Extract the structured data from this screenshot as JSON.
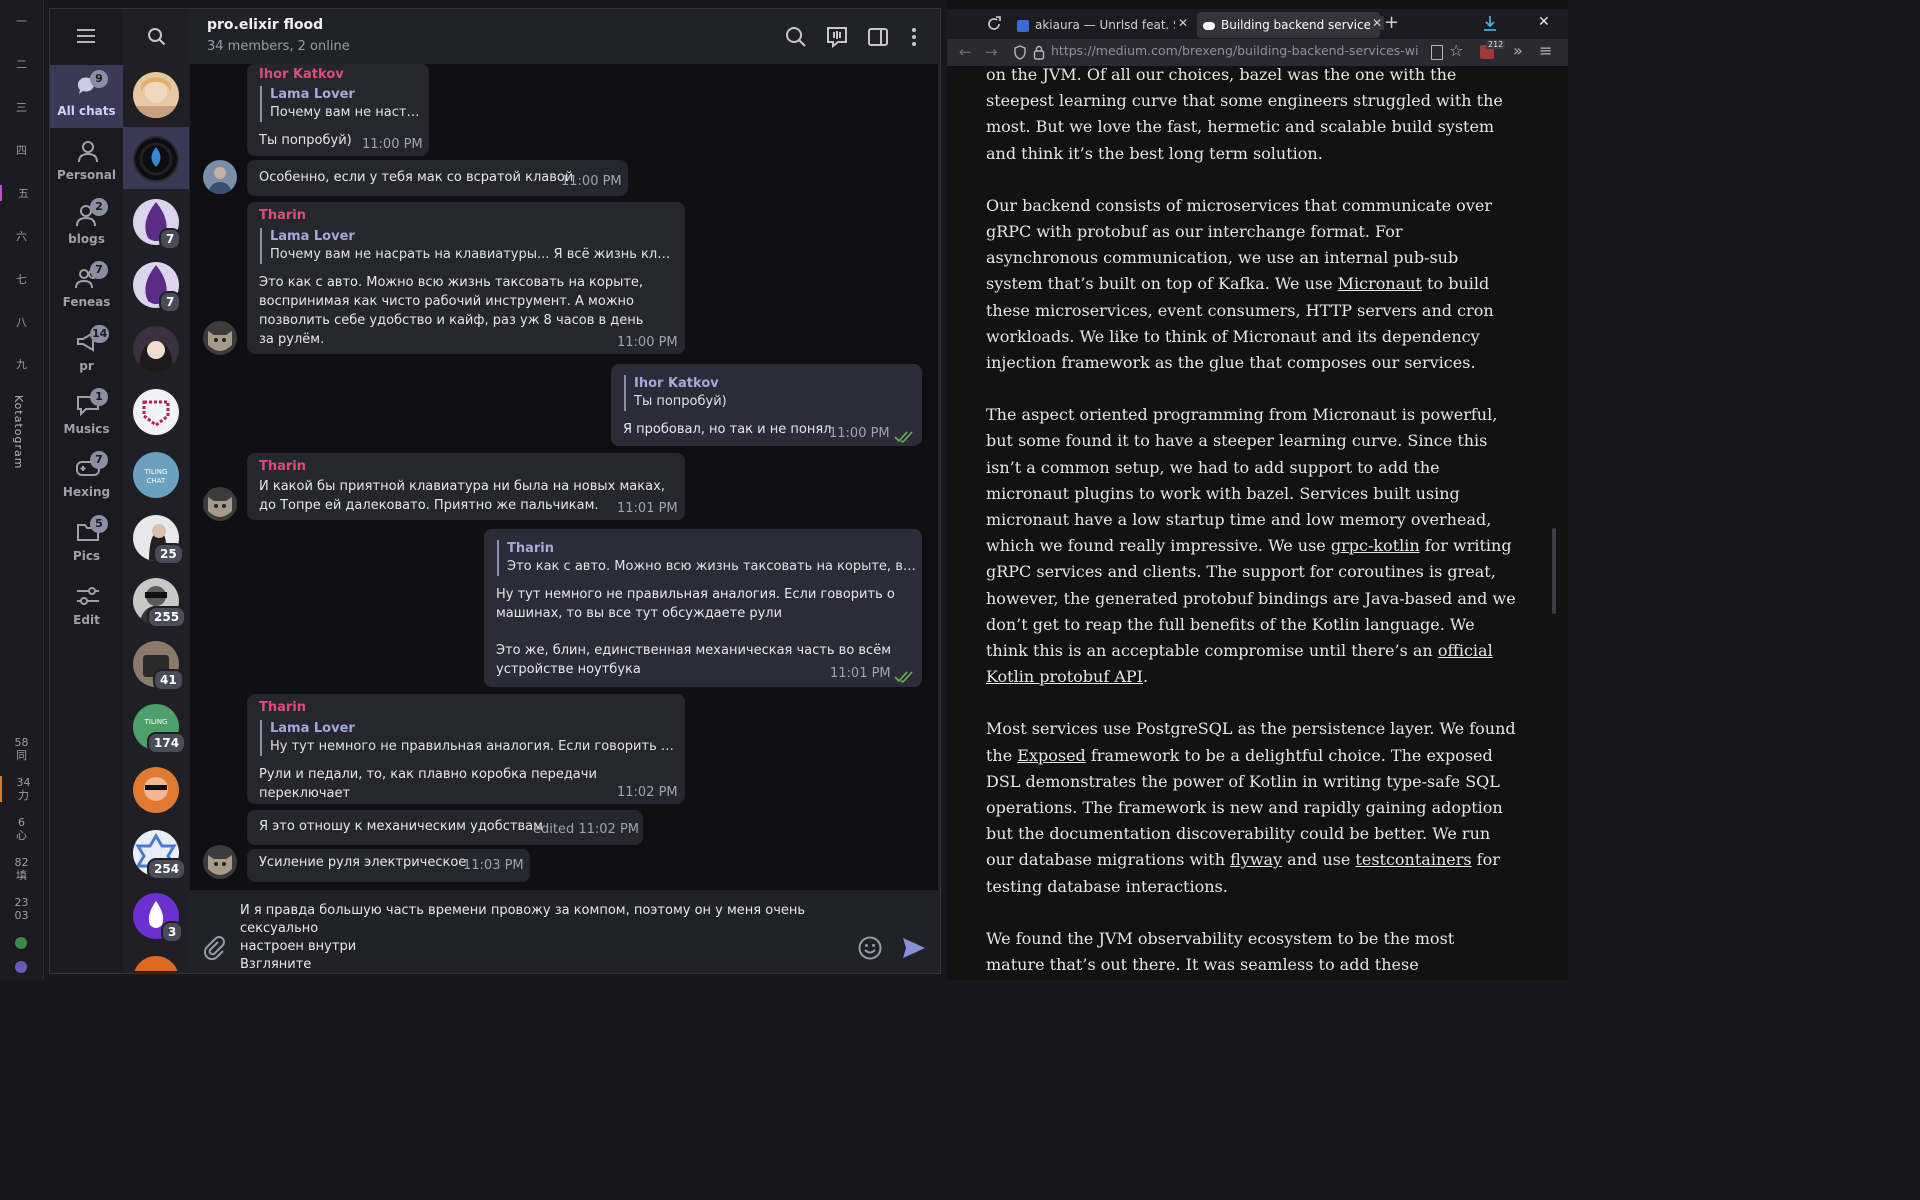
{
  "wm": {
    "workspaces": [
      "一",
      "二",
      "三",
      "四",
      "五",
      "六",
      "七",
      "八",
      "九"
    ],
    "title": "Kotatogram",
    "stats": [
      {
        "num": "58",
        "char": "同"
      },
      {
        "num": "34",
        "char": "力"
      },
      {
        "num": "6",
        "char": "心"
      },
      {
        "num": "82",
        "char": "填"
      },
      {
        "num": "23",
        "char": "03"
      }
    ]
  },
  "folders": [
    {
      "label": "All chats",
      "badge": "9",
      "icon": "chat-bubbles-icon"
    },
    {
      "label": "Personal",
      "badge": "",
      "icon": "person-icon"
    },
    {
      "label": "blogs",
      "badge": "2",
      "icon": "person-group-icon"
    },
    {
      "label": "Feneas",
      "badge": "7",
      "icon": "people-icon"
    },
    {
      "label": "pr",
      "badge": "14",
      "icon": "megaphone-icon"
    },
    {
      "label": "Musics",
      "badge": "1",
      "icon": "speech-icon"
    },
    {
      "label": "Hexing",
      "badge": "7",
      "icon": "gamepad-icon"
    },
    {
      "label": "Pics",
      "badge": "5",
      "icon": "folder-icon"
    },
    {
      "label": "Edit",
      "badge": "",
      "icon": "sliders-icon"
    }
  ],
  "chat_list_badges": [
    "",
    "",
    "7",
    "7",
    "",
    "",
    "",
    "25",
    "255",
    "41",
    "174",
    "",
    "254",
    "3"
  ],
  "chat": {
    "title": "pro.elixir flood",
    "subtitle": "34 members, 2 online"
  },
  "messages": [
    {
      "sender": "Ihor Katkov",
      "reply_name": "Lama Lover",
      "reply_text": "Почему вам не настр...",
      "text": "Ты попробуй)",
      "time": "11:00 PM"
    },
    {
      "sender": "",
      "text": "Особенно, если у тебя мак со всратой клавой",
      "time": "11:00 PM"
    },
    {
      "sender": "Tharin",
      "reply_name": "Lama Lover",
      "reply_text": "Почему вам не насрать на клавиатуры... Я всё жизнь клацаю ...",
      "text": "Это как с авто. Можно всю жизнь таксовать на корыте, воспринимая как чисто рабочий инструмент. А можно позволить себе удобство и кайф, раз уж 8 часов в день за рулём.",
      "time": "11:00 PM"
    },
    {
      "sender": "",
      "reply_name": "Ihor Katkov",
      "reply_text": "Ты попробуй)",
      "text": "Я пробовал, но так и не понял",
      "time": "11:00 PM"
    },
    {
      "sender": "Tharin",
      "text": "И какой бы приятной клавиатура ни была на новых маках, до Топре ей далековато. Приятно же пальчикам.",
      "time": "11:01 PM"
    },
    {
      "sender": "",
      "reply_name": "Tharin",
      "reply_text": "Это как с авто. Можно всю жизнь таксовать на корыте, воспр...",
      "text1": "Ну тут немного не правильная аналогия. Если говорить о машинах, то вы все тут обсуждаете рули",
      "text2": "Это же, блин, единственная механическая часть во всём устройстве ноутбука",
      "time": "11:01 PM"
    },
    {
      "sender": "Tharin",
      "reply_name": "Lama Lover",
      "reply_text": "Ну тут немного не правильная аналогия. Если говорить о ма...",
      "text": "Рули и педали, то, как плавно коробка передачи переключает",
      "time": "11:02 PM"
    },
    {
      "sender": "",
      "text": "Я это отношу к механическим удобствам",
      "time": "edited 11:02 PM"
    },
    {
      "sender": "",
      "text": "Усиление руля электрическое",
      "time": "11:03 PM"
    }
  ],
  "composer": {
    "text_line1": "И я правда большую часть времени провожу за компом, поэтому он у меня очень сексуально",
    "text_line2": "настроен внутри",
    "text_line3": "Взгляните"
  },
  "browser": {
    "tabs": [
      {
        "title": "akiaura — Unrlsd feat. ST"
      },
      {
        "title": "Building backend services"
      }
    ],
    "url": "https://medium.com/brexeng/building-backend-services-with-kot",
    "ext_badge": "212"
  },
  "article": {
    "p0": "on the JVM. Of all our choices, bazel was the one with the steepest learning curve that some engineers struggled with the most. But we love the fast, hermetic and scalable build system and think it’s the best long term solution.",
    "p1_a": "Our backend consists of microservices that communicate over gRPC with protobuf as our interchange format. For asynchronous communication, we use an internal pub-sub system that’s built on top of Kafka. We use ",
    "p1_link": "Micronaut",
    "p1_b": " to build these microservices, event consumers, HTTP servers and cron workloads. We like to think of Micronaut and its dependency injection framework as the glue that composes our services.",
    "p2_a": "The aspect oriented programming from Micronaut is powerful, but some found it to have a steeper learning curve. Since this isn’t a common setup, we had to add support to add the micronaut plugins to work with bazel. Services built using micronaut have a low startup time and low memory overhead, which we found really impressive. We use ",
    "p2_link1": "grpc-kotlin",
    "p2_b": " for writing gRPC services and clients. The support for coroutines is great, however, the generated protobuf bindings are Java-based and we don’t get to reap the full benefits of the Kotlin language. We think this is an acceptable compromise until there’s an ",
    "p2_link2": "official Kotlin protobuf API",
    "p2_c": ".",
    "p3_a": "Most services use PostgreSQL as the persistence layer. We found the ",
    "p3_link1": "Exposed",
    "p3_b": " framework to be a delightful choice. The exposed DSL demonstrates the power of Kotlin in writing type-safe SQL operations. The framework is new and rapidly gaining adoption but the documentation discoverability could be better. We run our database migrations with ",
    "p3_link2": "flyway",
    "p3_c": " and use ",
    "p3_link3": "testcontainers",
    "p3_d": " for testing database interactions.",
    "p4": "We found the JVM observability ecosystem to be the most mature that’s out there. It was seamless to add these integrations using Micronaut. We use opentracing for distributed tracing and micrometer for"
  }
}
